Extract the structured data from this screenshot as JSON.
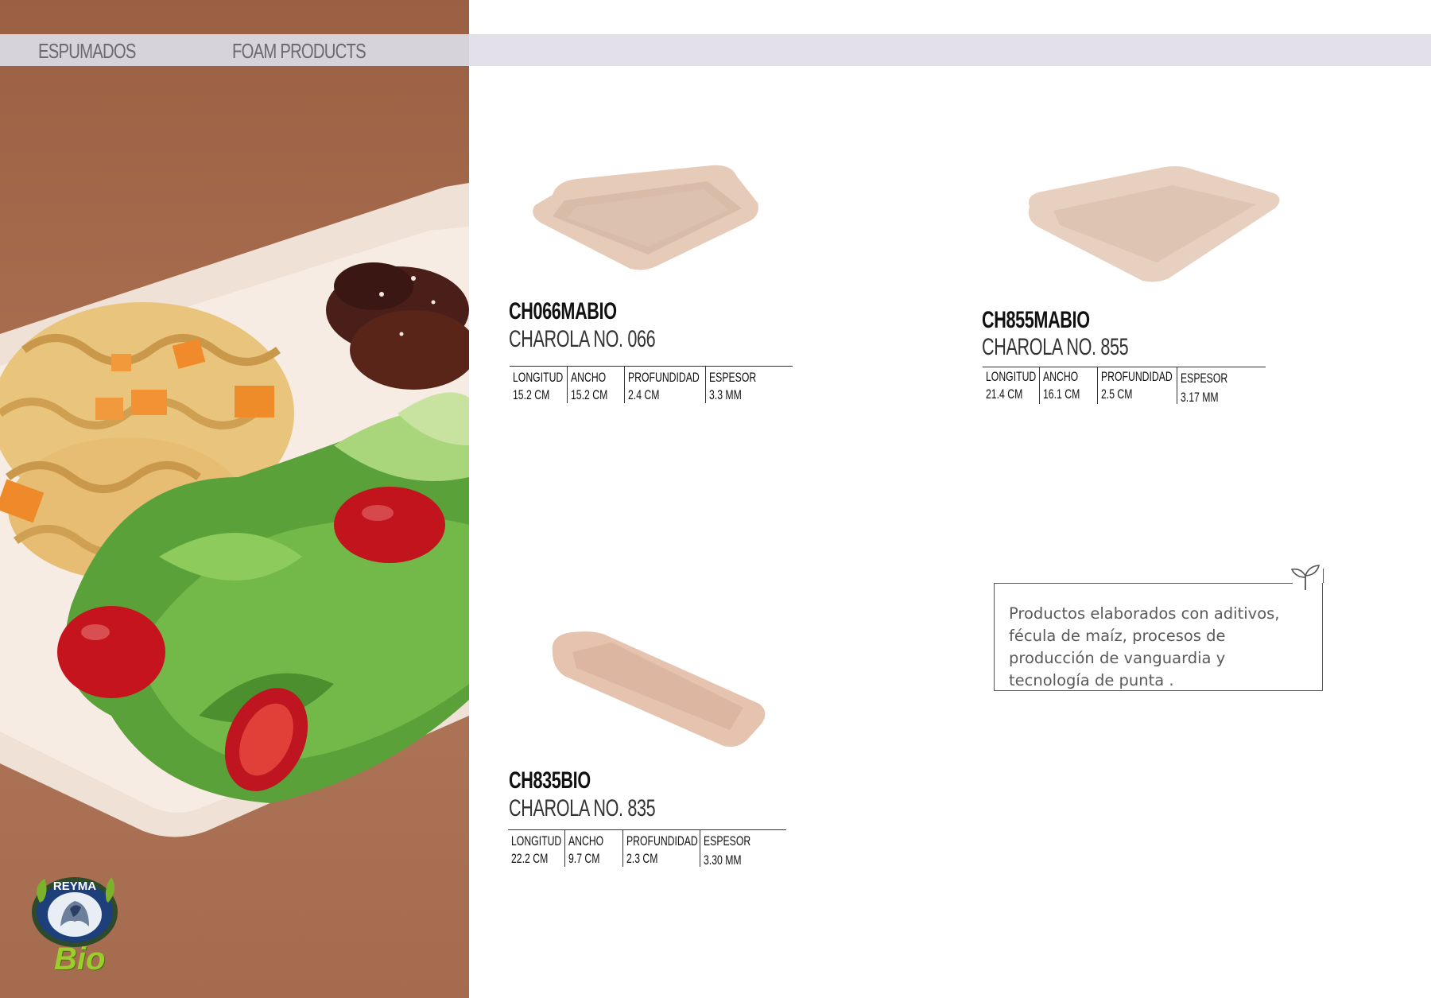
{
  "header": {
    "section_es": "ESPUMADOS",
    "section_en": "FOAM PRODUCTS"
  },
  "spec_labels": {
    "length": "LONGITUD",
    "width": "ANCHO",
    "depth": "PROFUNDIDAD",
    "thickness": "ESPESOR"
  },
  "products": [
    {
      "code": "CH066MABIO",
      "name": "CHAROLA NO. 066",
      "length": "15.2 CM",
      "width": "15.2 CM",
      "depth": "2.4 CM",
      "thickness": "3.3 MM"
    },
    {
      "code": "CH855MABIO",
      "name": "CHAROLA NO. 855",
      "length": "21.4 CM",
      "width": "16.1 CM",
      "depth": "2.5 CM",
      "thickness": "3.17 MM"
    },
    {
      "code": "CH835BIO",
      "name": "CHAROLA NO. 835",
      "length": "22.2 CM",
      "width": "9.7 CM",
      "depth": "2.3 CM",
      "thickness": "3.30 MM"
    }
  ],
  "eco_note": "Productos elaborados con aditivos, fécula de maíz, procesos de producción de vanguardia y  tecnología de punta .",
  "logo": {
    "brand": "REYMA",
    "sub": "Bio"
  },
  "colors": {
    "tray": "#e8cfc0",
    "photo_bg": "#a56b4f",
    "band": "#e4e0e9",
    "bio_green": "#9ccc2e"
  }
}
